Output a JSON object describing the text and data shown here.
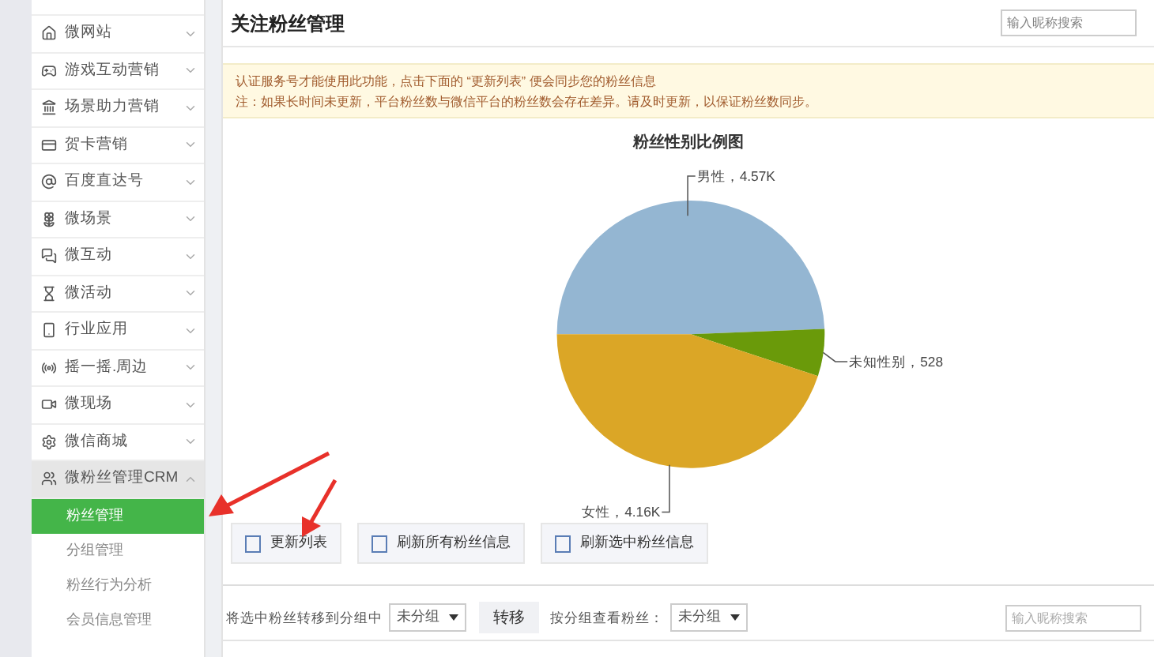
{
  "sidebar": {
    "items": [
      {
        "label": "微网站",
        "expanded": false
      },
      {
        "label": "游戏互动营销",
        "expanded": false
      },
      {
        "label": "场景助力营销",
        "expanded": false
      },
      {
        "label": "贺卡营销",
        "expanded": false
      },
      {
        "label": "百度直达号",
        "expanded": false
      },
      {
        "label": "微场景",
        "expanded": false
      },
      {
        "label": "微互动",
        "expanded": false
      },
      {
        "label": "微活动",
        "expanded": false
      },
      {
        "label": "行业应用",
        "expanded": false
      },
      {
        "label": "摇一摇.周边",
        "expanded": false
      },
      {
        "label": "微现场",
        "expanded": false
      },
      {
        "label": "微信商城",
        "expanded": false
      },
      {
        "label": "微粉丝管理CRM",
        "expanded": true,
        "children": [
          {
            "label": "粉丝管理",
            "selected": true
          },
          {
            "label": "分组管理",
            "selected": false
          },
          {
            "label": "粉丝行为分析",
            "selected": false
          },
          {
            "label": "会员信息管理",
            "selected": false
          }
        ]
      }
    ]
  },
  "page": {
    "title": "关注粉丝管理",
    "search": {
      "placeholder": "输入昵称搜索"
    }
  },
  "notice": [
    "认证服务号才能使用此功能，点击下面的 “更新列表” 便会同步您的粉丝信息",
    "注：如果长时间未更新，平台粉丝数与微信平台的粉丝数会存在差异。请及时更新，以保证粉丝数同步。"
  ],
  "chart": {
    "chart_data": {
      "type": "pie",
      "title": "粉丝性别比例图",
      "categories": [
        "男性",
        "未知性别",
        "女性"
      ],
      "values": [
        4570,
        528,
        4160
      ],
      "value_labels": [
        "4.57K",
        "528",
        "4.16K"
      ],
      "colors": [
        "#94b6d2",
        "#6a9a0a",
        "#dba626"
      ]
    },
    "label_separator": "，"
  },
  "actions": [
    {
      "label": "更新列表"
    },
    {
      "label": "刷新所有粉丝信息"
    },
    {
      "label": "刷新选中粉丝信息"
    }
  ],
  "toolbar": {
    "move_label": "将选中粉丝转移到分组中",
    "move_select": "未分组",
    "move_button": "转移",
    "filter_label": "按分组查看粉丝：",
    "filter_select": "未分组",
    "search": {
      "placeholder": "输入昵称搜索"
    }
  }
}
